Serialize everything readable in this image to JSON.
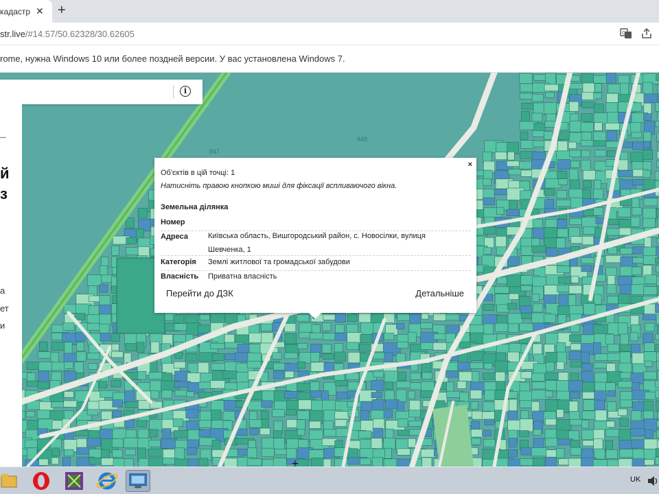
{
  "browser": {
    "tab_title": "кадастр",
    "tab_close": "✕",
    "new_tab": "+",
    "url_host": "str.live",
    "url_hash": "/#14.57/50.62328/30.62605",
    "translate_icon": "translate-icon",
    "share_icon": "share-icon"
  },
  "infobar": {
    "text": "rome, нужна Windows 10 или более поздней версии. У вас установлена Windows 7."
  },
  "side_panel": {
    "fragments": [
      "й",
      "з",
      "а",
      "ет",
      "и"
    ]
  },
  "map": {
    "labels": [
      "847",
      "848"
    ],
    "colors": {
      "base": "#5ba9a3",
      "parcel": "#57c4a5",
      "parcel_dark": "#3aa889",
      "parcel_blue": "#4b8fc0",
      "parcel_light": "#9fe0c0",
      "road": "#e9ebe4"
    }
  },
  "popup": {
    "close": "×",
    "count": "Об'єктів в цій точці: 1",
    "hint": "Натисніть правою кнопкою миші для фіксації вспливаючого вікна.",
    "section": "Земельна ділянка",
    "rows": [
      {
        "label": "Номер",
        "value": ""
      },
      {
        "label": "Адреса",
        "value": "Київська область, Вишгородський район, с. Новосілки, вулиця Шевченка, 1"
      },
      {
        "label": "Категорія",
        "value": "Землі житлової та громадської забудови"
      },
      {
        "label": "Власність",
        "value": "Приватна власність"
      }
    ],
    "link_left": "Перейти до ДЗК",
    "link_right": "Детальніше"
  },
  "taskbar": {
    "items": [
      "explorer-icon",
      "opera-icon",
      "winrar-icon",
      "internet-explorer-icon",
      "remote-desktop-icon"
    ],
    "language": "UK"
  }
}
